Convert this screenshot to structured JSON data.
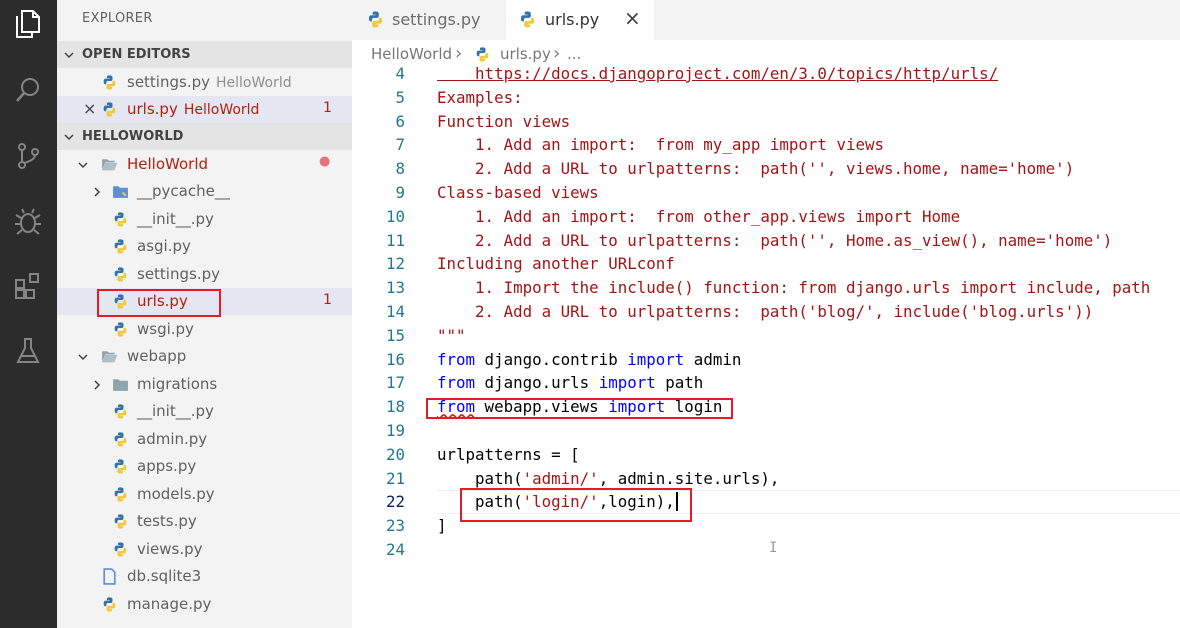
{
  "explorer": {
    "title": "EXPLORER",
    "sections": {
      "open_editors": "OPEN EDITORS",
      "project": "HELLOWORLD"
    },
    "open_editors": [
      {
        "name": "settings.py",
        "folder": "HelloWorld",
        "problems": ""
      },
      {
        "name": "urls.py",
        "folder": "HelloWorld",
        "problems": "1"
      }
    ],
    "tree": [
      {
        "label": "HelloWorld",
        "badge": "●"
      },
      {
        "label": "__pycache__"
      },
      {
        "label": "__init__.py"
      },
      {
        "label": "asgi.py"
      },
      {
        "label": "settings.py"
      },
      {
        "label": "urls.py",
        "badge": "1"
      },
      {
        "label": "wsgi.py"
      },
      {
        "label": "webapp"
      },
      {
        "label": "migrations"
      },
      {
        "label": "__init__.py"
      },
      {
        "label": "admin.py"
      },
      {
        "label": "apps.py"
      },
      {
        "label": "models.py"
      },
      {
        "label": "tests.py"
      },
      {
        "label": "views.py"
      },
      {
        "label": "db.sqlite3"
      },
      {
        "label": "manage.py"
      }
    ]
  },
  "tabs": [
    {
      "label": "settings.py"
    },
    {
      "label": "urls.py"
    }
  ],
  "breadcrumb": {
    "folder": "HelloWorld",
    "file": "urls.py",
    "sep": "›",
    "more": "..."
  },
  "editor": {
    "lines": [
      {
        "n": "4",
        "t": "    https://docs.djangoproject.com/en/3.0/topics/http/urls/"
      },
      {
        "n": "5",
        "t": "Examples:"
      },
      {
        "n": "6",
        "t": "Function views"
      },
      {
        "n": "7",
        "t": "    1. Add an import:  from my_app import views"
      },
      {
        "n": "8",
        "t": "    2. Add a URL to urlpatterns:  path('', views.home, name='home')"
      },
      {
        "n": "9",
        "t": "Class-based views"
      },
      {
        "n": "10",
        "t": "    1. Add an import:  from other_app.views import Home"
      },
      {
        "n": "11",
        "t": "    2. Add a URL to urlpatterns:  path('', Home.as_view(), name='home')"
      },
      {
        "n": "12",
        "t": "Including another URLconf"
      },
      {
        "n": "13",
        "t": "    1. Import the include() function: from django.urls import include, path"
      },
      {
        "n": "14",
        "t": "    2. Add a URL to urlpatterns:  path('blog/', include('blog.urls'))"
      },
      {
        "n": "15",
        "t": "\"\"\""
      },
      {
        "n": "16",
        "kw": "from",
        "a": " django.contrib ",
        "kw2": "import",
        "b": " admin"
      },
      {
        "n": "17",
        "kw": "from",
        "a": " django.urls ",
        "kw2": "import",
        "b": " path"
      },
      {
        "n": "18",
        "kw": "from",
        "a": " webapp.views ",
        "kw2": "import",
        "b": " login"
      },
      {
        "n": "19",
        "t": ""
      },
      {
        "n": "20",
        "t": "urlpatterns = ["
      },
      {
        "n": "21",
        "p": "    path(",
        "str": "'admin/'",
        "r": ", admin.site.urls),"
      },
      {
        "n": "22",
        "p": "    path(",
        "str": "'login/'",
        "r": ",login),"
      },
      {
        "n": "23",
        "t": "]"
      },
      {
        "n": "24",
        "t": ""
      }
    ]
  },
  "colors": {
    "activity_bg": "#2c2c2c",
    "sidebar_bg": "#f3f3f3",
    "string": "#a31515",
    "keyword": "#0000ff",
    "line_number": "#237893",
    "highlight_box": "#e51c23"
  }
}
